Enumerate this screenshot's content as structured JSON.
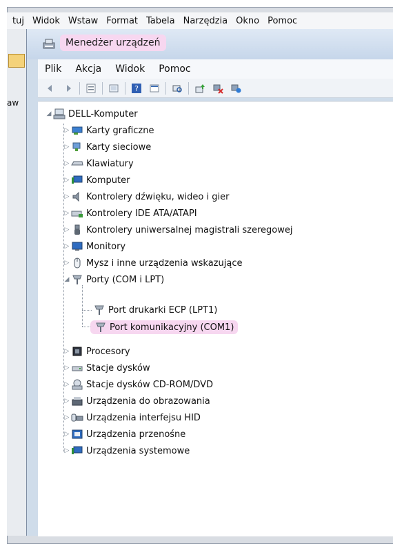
{
  "background_menu": [
    "tuj",
    "Widok",
    "Wstaw",
    "Format",
    "Tabela",
    "Narzędzia",
    "Okno",
    "Pomoc"
  ],
  "left_stub_text": "aw",
  "window": {
    "title": "Menedżer urządzeń",
    "menu": [
      "Plik",
      "Akcja",
      "Widok",
      "Pomoc"
    ]
  },
  "toolbar_icons": [
    "back-icon",
    "forward-icon",
    "properties-icon",
    "view-icon",
    "help-icon",
    "console-icon",
    "scan-icon",
    "update-driver-icon",
    "uninstall-icon",
    "enable-icon"
  ],
  "tree": {
    "root": "DELL-Komputer",
    "items": [
      {
        "label": "Karty graficzne",
        "icon": "display-adapter-icon"
      },
      {
        "label": "Karty sieciowe",
        "icon": "network-adapter-icon"
      },
      {
        "label": "Klawiatury",
        "icon": "keyboard-icon"
      },
      {
        "label": "Komputer",
        "icon": "computer-icon"
      },
      {
        "label": "Kontrolery dźwięku, wideo i gier",
        "icon": "sound-icon"
      },
      {
        "label": "Kontrolery IDE ATA/ATAPI",
        "icon": "ide-controller-icon"
      },
      {
        "label": "Kontrolery uniwersalnej magistrali szeregowej",
        "icon": "usb-icon"
      },
      {
        "label": "Monitory",
        "icon": "monitor-icon"
      },
      {
        "label": "Mysz i inne urządzenia wskazujące",
        "icon": "mouse-icon"
      },
      {
        "label": "Porty (COM i LPT)",
        "icon": "port-icon"
      },
      {
        "label": "Procesory",
        "icon": "cpu-icon"
      },
      {
        "label": "Stacje dysków",
        "icon": "disk-drive-icon"
      },
      {
        "label": "Stacje dysków CD-ROM/DVD",
        "icon": "cdrom-icon"
      },
      {
        "label": "Urządzenia do obrazowania",
        "icon": "imaging-icon"
      },
      {
        "label": "Urządzenia interfejsu HID",
        "icon": "hid-icon"
      },
      {
        "label": "Urządzenia przenośne",
        "icon": "portable-icon"
      },
      {
        "label": "Urządzenia systemowe",
        "icon": "system-icon"
      }
    ],
    "ports_children": [
      "Port drukarki ECP (LPT1)",
      "Port komunikacyjny (COM1)"
    ]
  },
  "highlight_color": "#f7d7f0"
}
